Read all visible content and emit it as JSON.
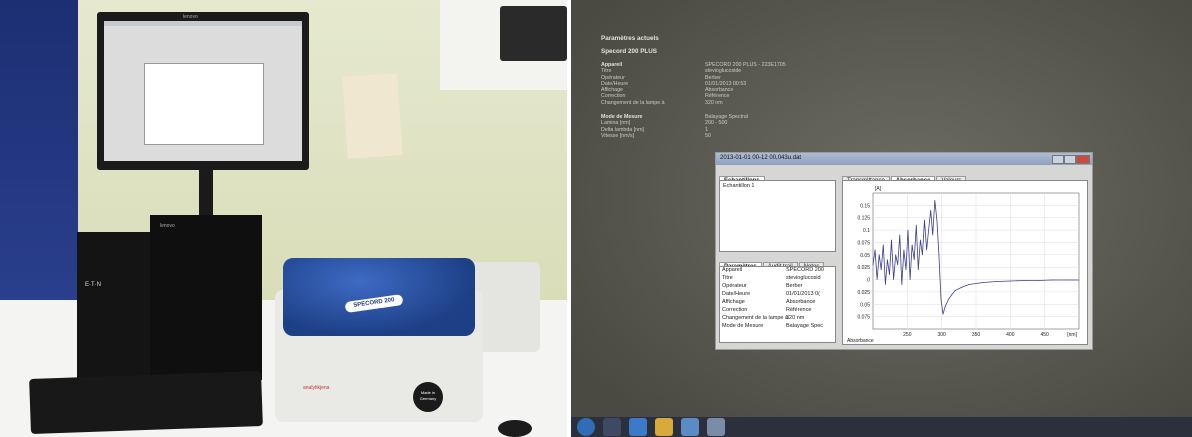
{
  "left_photo": {
    "monitor_brand": "lenovo",
    "tower_brand": "lenovo",
    "instrument_name": "SPECORD 200",
    "instrument_make": "analytikjena",
    "made_in": "Made in Germany",
    "ups_brand": "E·T·N"
  },
  "right_photo": {
    "header": {
      "title": "Paramètres actuels",
      "device_name": "Specord 200 PLUS"
    },
    "params_block": [
      {
        "label": "Appareil",
        "value": "SPECORD 200 PLUS - 223E1705"
      },
      {
        "label": "Titre",
        "value": "stevioglucoside"
      },
      {
        "label": "Opérateur",
        "value": "Berber"
      },
      {
        "label": "Date/Heure",
        "value": "01/01/2013 00:53"
      },
      {
        "label": "Affichage",
        "value": "Absorbance"
      },
      {
        "label": "Correction",
        "value": "Référence"
      },
      {
        "label": "Changement de la lampe à",
        "value": "320 nm"
      }
    ],
    "mode_block": [
      {
        "label": "Mode de Mesure",
        "value": "Balayage Spectral"
      },
      {
        "label": "Lamina [nm]",
        "value": "200 - 500"
      },
      {
        "label": "Delta lambda [nm]",
        "value": "1"
      },
      {
        "label": "Vitesse [nm/s]",
        "value": "50"
      }
    ],
    "window": {
      "title": "2013-01-01 00-12 00,043u.dat",
      "samples_tab": "Echantillons",
      "sample_item": "Echantillon 1",
      "lower_tabs": [
        "Paramètres",
        "Audit trail",
        "Notes"
      ],
      "lower_rows": [
        {
          "label": "Appareil",
          "value": "SPECORD 200"
        },
        {
          "label": "Titre",
          "value": "stevioglucosid"
        },
        {
          "label": "Opérateur",
          "value": "Berber"
        },
        {
          "label": "Date/Heure",
          "value": "01/01/2013 0("
        },
        {
          "label": "Affichage",
          "value": "Absorbance"
        },
        {
          "label": "Correction",
          "value": "Référence"
        },
        {
          "label": "Changement de la lampe à",
          "value": "320 nm"
        },
        {
          "label": "Mode de Mesure",
          "value": "Balayage Spec"
        }
      ],
      "chart_tabs": [
        "Transmittance",
        "Absorbance",
        "Valeurs"
      ],
      "ylabel": "[A]",
      "xlabel_unit": "[nm]",
      "x_title": "Absorbance"
    },
    "chart_data": {
      "type": "line",
      "title": "",
      "xlabel": "[nm]",
      "ylabel": "[A]",
      "xlim": [
        200,
        500
      ],
      "ylim": [
        -0.1,
        0.175
      ],
      "x_ticks": [
        "250",
        "300",
        "350",
        "400",
        "450"
      ],
      "y_ticks": [
        "0.15",
        "0.125",
        "0.1",
        "0.075",
        "0.05",
        "0.025",
        "0",
        "0.025",
        "0.05",
        "0.075"
      ],
      "series": [
        {
          "x": [
            200,
            203,
            206,
            209,
            212,
            215,
            218,
            221,
            224,
            227,
            230,
            233,
            236,
            239,
            242,
            245,
            248,
            251,
            254,
            257,
            260,
            263,
            266,
            269,
            272,
            275,
            278,
            281,
            284,
            287,
            290,
            293,
            296,
            299,
            302,
            305,
            310,
            315,
            320,
            330,
            340,
            360,
            380,
            400,
            420,
            440,
            460,
            480,
            500
          ],
          "y": [
            0.03,
            0.06,
            0.0,
            0.05,
            0.02,
            0.07,
            -0.01,
            0.04,
            0.01,
            0.08,
            0.0,
            0.05,
            0.03,
            0.09,
            -0.01,
            0.06,
            0.02,
            0.1,
            0.0,
            0.07,
            0.04,
            0.11,
            0.02,
            0.08,
            0.05,
            0.12,
            0.06,
            0.1,
            0.14,
            0.09,
            0.16,
            0.12,
            0.05,
            -0.04,
            -0.07,
            -0.055,
            -0.04,
            -0.03,
            -0.022,
            -0.015,
            -0.01,
            -0.006,
            -0.004,
            -0.003,
            -0.002,
            -0.002,
            -0.001,
            -0.001,
            -0.001
          ]
        }
      ]
    },
    "taskbar_icons": [
      "start-orb-icon",
      "explorer-icon",
      "ie-icon",
      "folder-icon",
      "media-icon",
      "app-icon"
    ]
  }
}
